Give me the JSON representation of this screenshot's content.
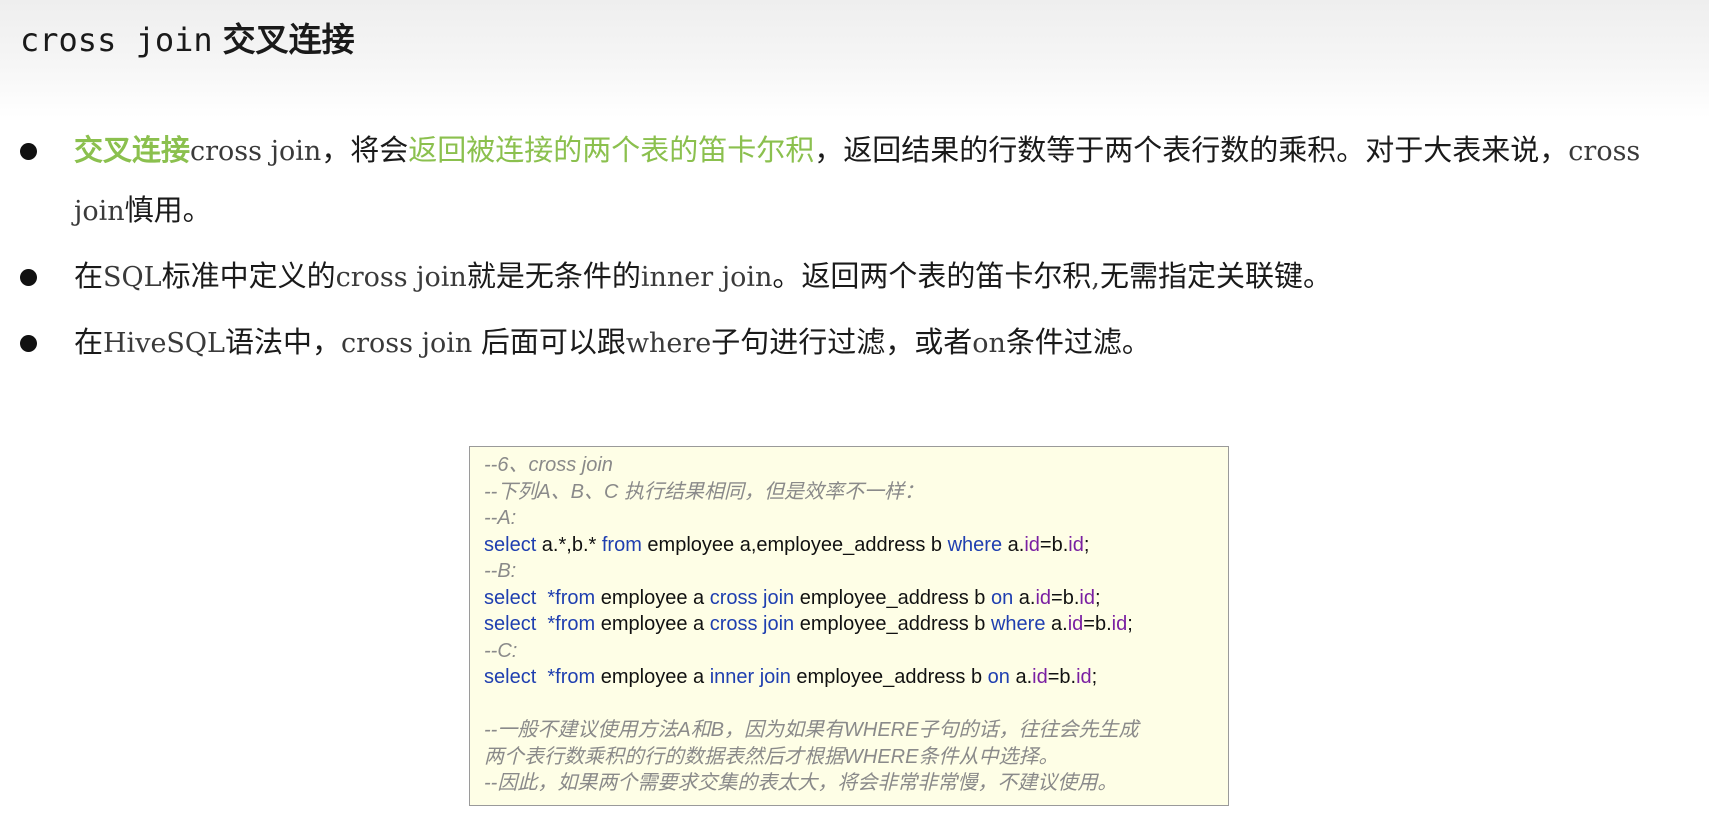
{
  "title": {
    "mono": "cross join",
    "cn": "交叉连接"
  },
  "bullets": [
    {
      "b1_term": "交叉连接",
      "b1_en1": "cross join",
      "b1_t2": "，将会",
      "b1_hl": "返回被连接的两个表的笛卡尔积",
      "b1_t3": "，返回结果的行数等于两个表行数的乘积。对于大表来说，",
      "b1_en2": "cross join",
      "b1_t4": "慎用。"
    },
    {
      "b2_t1": "在",
      "b2_en1": "SQL",
      "b2_t2": "标准中定义的",
      "b2_en2": "cross join",
      "b2_t3": "就是无条件的",
      "b2_en3": "inner join",
      "b2_t4": "。返回两个表的笛卡尔积",
      "b2_en4": ",",
      "b2_t5": "无需指定关联键。"
    },
    {
      "b3_t1": "在",
      "b3_en1": "HiveSQL",
      "b3_t2": "语法中，",
      "b3_en2": "cross join ",
      "b3_t3": "后面可以跟",
      "b3_en3": "where",
      "b3_t4": "子句进行过滤，或者",
      "b3_en4": "on",
      "b3_t5": "条件过滤。"
    }
  ],
  "code": {
    "c1": "--6、cross join",
    "c2": "--下列A、B、C 执行结果相同，但是效率不一样：",
    "c3": "--A:",
    "c4": "--B:",
    "c5": "--C:",
    "c6": "--一般不建议使用方法A和B，因为如果有WHERE子句的话，往往会先生成",
    "c7": "两个表行数乘积的行的数据表然后才根据WHERE条件从中选择。",
    "c8": "--因此，如果两个需要求交集的表太大，将会非常非常慢，不建议使用。",
    "kw_select": "select",
    "kw_from": "from",
    "kw_from_star": "*from",
    "kw_where": "where",
    "kw_cross_join": "cross join",
    "kw_inner_join": "inner join",
    "kw_on": "on",
    "a_cols": " a.*,b.* ",
    "a_tables": " employee a,employee_address b ",
    "tbl_a": " employee a ",
    "tbl_b": " employee_address b ",
    "ref_a": " a.",
    "col_id": "id",
    "eq_b": "=b.",
    "semi": ";"
  },
  "colors": {
    "highlight_green": "#8bc04e",
    "keyword_blue": "#1f3fb0",
    "column_purple": "#7a1fa2",
    "comment_gray": "#8a8a8a",
    "code_bg": "#fefee6"
  }
}
